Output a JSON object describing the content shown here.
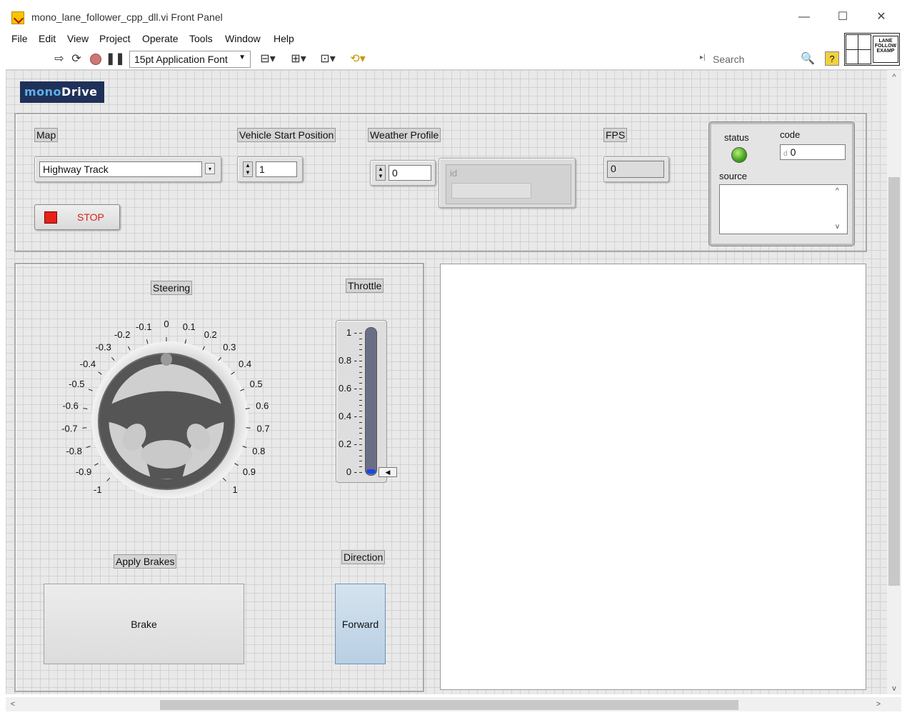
{
  "window": {
    "title": "mono_lane_follower_cpp_dll.vi Front Panel",
    "minimize": "—",
    "maximize": "☐",
    "close": "✕"
  },
  "menu": [
    "File",
    "Edit",
    "View",
    "Project",
    "Operate",
    "Tools",
    "Window",
    "Help"
  ],
  "toolbar": {
    "run_icon": "run-arrow-icon",
    "font": "15pt Application Font",
    "search_placeholder": "Search",
    "help": "?",
    "vi_icon_text": "LANE FOLLOW EXAMP"
  },
  "logo": {
    "part1": "mono",
    "part2": "Drive"
  },
  "config": {
    "map_label": "Map",
    "map_value": "Highway Track",
    "start_label": "Vehicle Start Position",
    "start_value": "1",
    "weather_label": "Weather Profile",
    "weather_value": "0",
    "weather_id_label": "id",
    "fps_label": "FPS",
    "fps_value": "0",
    "stop_label": "STOP"
  },
  "error_cluster": {
    "status_label": "status",
    "code_label": "code",
    "code_prefix": "d",
    "code_value": "0",
    "source_label": "source",
    "status_color": "#42a11a"
  },
  "steering": {
    "label": "Steering",
    "ticks": [
      "-1",
      "-0.9",
      "-0.8",
      "-0.7",
      "-0.6",
      "-0.5",
      "-0.4",
      "-0.3",
      "-0.2",
      "-0.1",
      "0",
      "0.1",
      "0.2",
      "0.3",
      "0.4",
      "0.5",
      "0.6",
      "0.7",
      "0.8",
      "0.9",
      "1"
    ],
    "value": 0
  },
  "throttle": {
    "label": "Throttle",
    "ticks": [
      "1",
      "0.8",
      "0.6",
      "0.4",
      "0.2",
      "0"
    ],
    "value": 0
  },
  "brakes": {
    "label": "Apply Brakes",
    "button": "Brake"
  },
  "direction": {
    "label": "Direction",
    "button": "Forward"
  },
  "scroll": {
    "up": "^",
    "down": "v",
    "left": "<",
    "right": ">"
  }
}
